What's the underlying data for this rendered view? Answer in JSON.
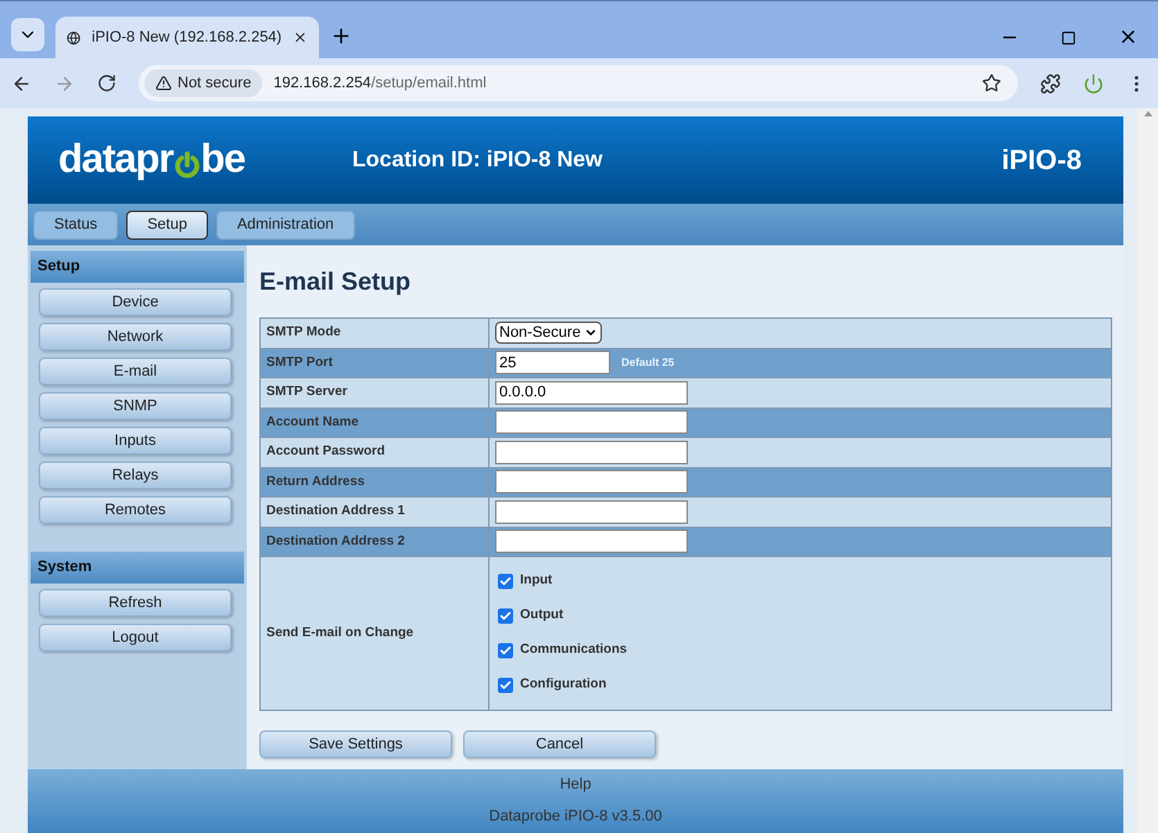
{
  "browser": {
    "tab_title": "iPIO-8 New (192.168.2.254)",
    "security": "Not secure",
    "url_host": "192.168.2.254",
    "url_path": "/setup/email.html"
  },
  "header": {
    "logo": {
      "before": "datapr",
      "after": "be"
    },
    "location": "Location ID: iPIO-8 New",
    "model": "iPIO-8"
  },
  "nav_tabs": [
    {
      "label": "Status",
      "selected": false
    },
    {
      "label": "Setup",
      "selected": true
    },
    {
      "label": "Administration",
      "selected": false
    }
  ],
  "sidebar": [
    {
      "title": "Setup",
      "items": [
        "Device",
        "Network",
        "E-mail",
        "SNMP",
        "Inputs",
        "Relays",
        "Remotes"
      ]
    },
    {
      "title": "System",
      "items": [
        "Refresh",
        "Logout"
      ]
    }
  ],
  "page_title": "E-mail Setup",
  "form": [
    {
      "label": "SMTP Mode",
      "kind": "select",
      "value": "Non-Secure"
    },
    {
      "label": "SMTP Port",
      "kind": "short",
      "value": "25",
      "hint": "Default 25"
    },
    {
      "label": "SMTP Server",
      "kind": "text",
      "value": "0.0.0.0"
    },
    {
      "label": "Account Name",
      "kind": "text"
    },
    {
      "label": "Account Password",
      "kind": "text"
    },
    {
      "label": "Return Address",
      "kind": "text"
    },
    {
      "label": "Destination Address 1",
      "kind": "text"
    },
    {
      "label": "Destination Address 2",
      "kind": "text"
    },
    {
      "label": "Send E-mail on Change",
      "kind": "checks",
      "options": [
        {
          "label": "Input",
          "checked": true
        },
        {
          "label": "Output",
          "checked": true
        },
        {
          "label": "Communications",
          "checked": true
        },
        {
          "label": "Configuration",
          "checked": true
        }
      ]
    }
  ],
  "buttons": [
    "Save Settings",
    "Cancel"
  ],
  "footer": {
    "link": "Help",
    "version": "Dataprobe iPIO-8 v3.5.00"
  }
}
